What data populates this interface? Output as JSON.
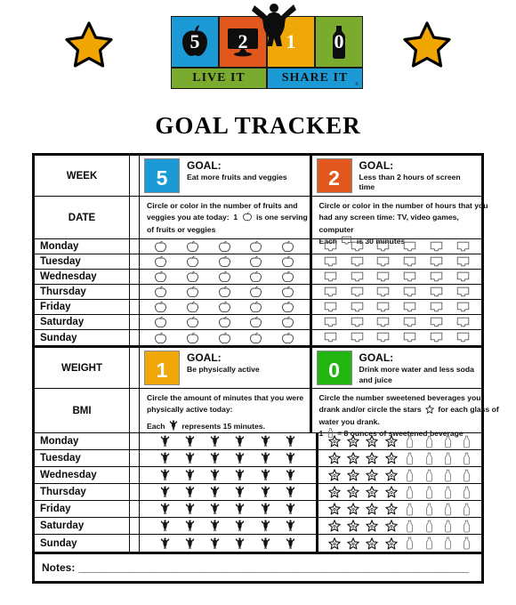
{
  "page": {
    "title": "GOAL TRACKER"
  },
  "logo": {
    "cells": [
      {
        "number": "5",
        "glyph": "apple-icon",
        "color": "#1b9ad6"
      },
      {
        "number": "2",
        "glyph": "tv-icon",
        "color": "#e2571e"
      },
      {
        "number": "1",
        "glyph": "jumping-person-icon",
        "color": "#f0a808"
      },
      {
        "number": "0",
        "glyph": "bottle-icon",
        "color": "#7aab2e"
      }
    ],
    "bars": [
      {
        "label": "LIVE IT",
        "color": "#7aab2e"
      },
      {
        "label": "SHARE IT",
        "color": "#1b9ad6",
        "registered": "®"
      }
    ]
  },
  "decorations": {
    "star_color": "#f0a500",
    "star_outline": "#000000"
  },
  "table": {
    "section1": {
      "row_week": {
        "label": "WEEK",
        "goals": [
          {
            "number": "5",
            "color": "#1b9ad6",
            "goal_label": "GOAL:",
            "goal_text": "Eat more fruits and  veggies"
          },
          {
            "number": "2",
            "color": "#e2571e",
            "goal_label": "GOAL:",
            "goal_text": "Less than 2 hours of screen time"
          }
        ]
      },
      "row_date": {
        "label": "DATE",
        "instructions": [
          {
            "lines": [
              "Circle or color in the number of fruits and",
              "veggies you ate today:  1 ○ is one serving",
              "of fruits or veggies"
            ],
            "inline_icon": "apple-icon"
          },
          {
            "lines": [
              "Circle or color in the number of hours that you",
              "had any screen time: TV, video games,",
              "computer",
              "Each □ is 30 minutes"
            ],
            "inline_icon": "tv-icon"
          }
        ]
      },
      "days": [
        "Monday",
        "Tuesday",
        "Wednesday",
        "Thursday",
        "Friday",
        "Saturday",
        "Sunday"
      ],
      "left_icon": "apple-icon",
      "left_icon_count": 5,
      "right_icon": "tv-icon",
      "right_icon_count": 6
    },
    "section2": {
      "row_weight": {
        "label": "WEIGHT",
        "goals": [
          {
            "number": "1",
            "color": "#f0a808",
            "goal_label": "GOAL:",
            "goal_text": "Be physically active"
          },
          {
            "number": "0",
            "color": "#22b512",
            "goal_label": "GOAL:",
            "goal_text_line1": "Drink more water and  less soda",
            "goal_text_line2": "and juice"
          }
        ]
      },
      "row_bmi": {
        "label": "BMI",
        "instructions": [
          {
            "lines": [
              "Circle the amount of minutes that you were",
              "physically active today:",
              "",
              "Each † represents 15 minutes."
            ],
            "inline_icon": "jumping-person-icon"
          },
          {
            "lines": [
              "Circle the number sweetened beverages you",
              "drank and/or circle the stars ☆for each glass of",
              "water you drank.",
              "1 ○ = 8 ounces of sweetened beverage"
            ],
            "inline_icon": "star-icon"
          }
        ]
      },
      "days": [
        "Monday",
        "Tuesday",
        "Wednesday",
        "Thursday",
        "Friday",
        "Saturday",
        "Sunday"
      ],
      "left_icon": "jumping-person-icon",
      "left_icon_count": 6,
      "right_star_icon": "star-icon",
      "right_star_count": 4,
      "right_bottle_icon": "bottle-icon",
      "right_bottle_count": 4
    },
    "notes": {
      "label": "Notes:",
      "line": "_______________________________________________________________________"
    }
  }
}
